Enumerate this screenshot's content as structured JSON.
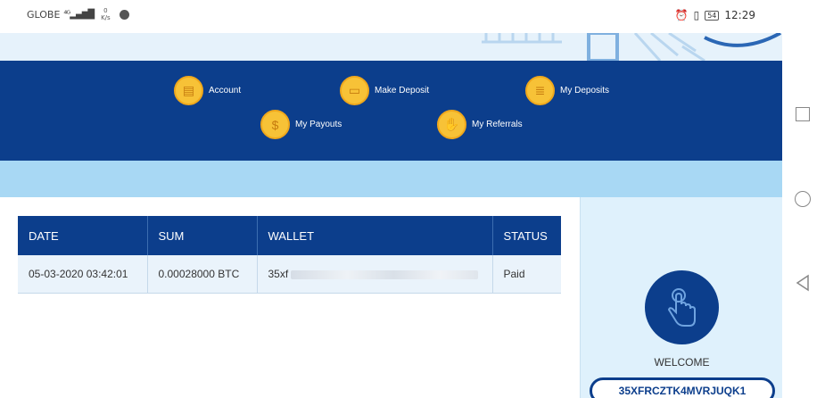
{
  "status_bar": {
    "carrier": "GLOBE",
    "net_speed_value": "0",
    "net_speed_unit": "K/s",
    "battery": "54",
    "time": "12:29"
  },
  "nav": {
    "items": [
      {
        "label": "Account",
        "icon": "wallet-icon"
      },
      {
        "label": "Make Deposit",
        "icon": "deposit-icon"
      },
      {
        "label": "My Deposits",
        "icon": "document-icon"
      },
      {
        "label": "My Payouts",
        "icon": "money-bag-icon"
      },
      {
        "label": "My Referrals",
        "icon": "handshake-icon"
      }
    ]
  },
  "table": {
    "headers": [
      "DATE",
      "SUM",
      "WALLET",
      "STATUS"
    ],
    "rows": [
      {
        "date": "05-03-2020 03:42:01",
        "sum": "0.00028000 BTC",
        "wallet": "35xf",
        "status": "Paid"
      }
    ]
  },
  "welcome": {
    "title": "WELCOME",
    "wallet": "35XFRCZTK4MVRJUQK1"
  },
  "colors": {
    "navy": "#0c3e8c",
    "coin": "#f7c237",
    "light_band": "#a8d8f4",
    "panel": "#dff1fc"
  }
}
